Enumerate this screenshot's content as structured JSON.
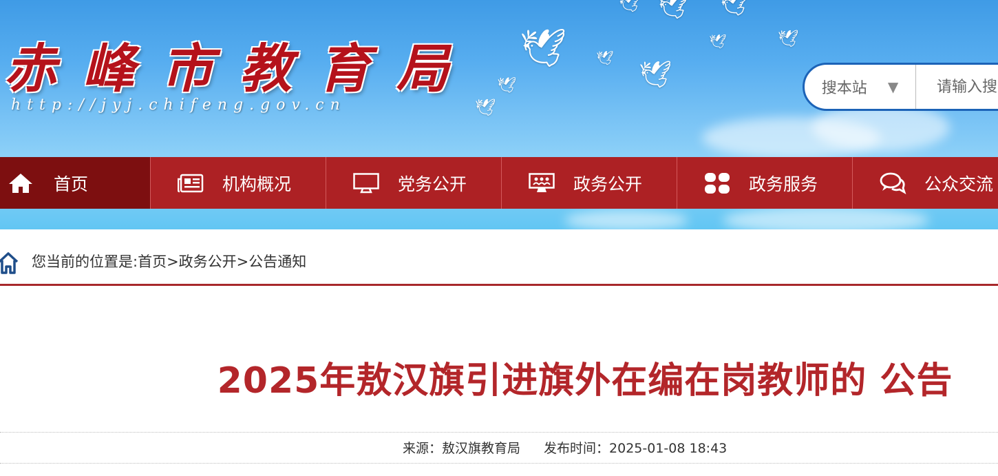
{
  "header": {
    "site_title": "赤峰市教育局",
    "site_url": "http://jyj.chifeng.gov.cn"
  },
  "search": {
    "scope_label": "搜本站",
    "scope_caret": "▼",
    "placeholder": "请输入搜"
  },
  "nav": {
    "items": [
      {
        "label": "首页",
        "icon": "home-icon"
      },
      {
        "label": "机构概况",
        "icon": "newspaper-icon"
      },
      {
        "label": "党务公开",
        "icon": "monitor-icon"
      },
      {
        "label": "政务公开",
        "icon": "presentation-icon"
      },
      {
        "label": "政务服务",
        "icon": "grid-icon"
      },
      {
        "label": "公众交流",
        "icon": "chat-icon"
      }
    ]
  },
  "breadcrumb": {
    "text": "您当前的位置是:首页>政务公开>公告通知",
    "icon": "house-outline-icon"
  },
  "article": {
    "title": "2025年敖汉旗引进旗外在编在岗教师的 公告",
    "source_label": "来源：",
    "source": "敖汉旗教育局",
    "date_label": "发布时间：",
    "date": "2025-01-08 18:43"
  },
  "colors": {
    "nav_bg": "#ad2124",
    "nav_active": "#7d0f10",
    "title_red": "#b3262a",
    "search_border": "#1c63b7"
  }
}
